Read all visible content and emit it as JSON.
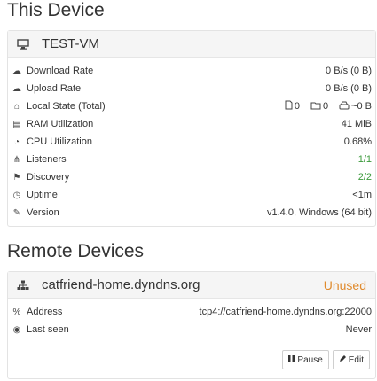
{
  "this_device": {
    "section_title": "This Device",
    "name": "TEST-VM",
    "rows": [
      {
        "icon": "cloud-download-icon",
        "glyph": "☁",
        "label": "Download Rate",
        "value": "0 B/s (0 B)"
      },
      {
        "icon": "cloud-upload-icon",
        "glyph": "☁",
        "label": "Upload Rate",
        "value": "0 B/s (0 B)"
      },
      {
        "icon": "home-icon",
        "glyph": "⌂",
        "label": "Local State (Total)"
      },
      {
        "icon": "memory-icon",
        "glyph": "▤",
        "label": "RAM Utilization",
        "value": "41 MiB"
      },
      {
        "icon": "tachometer-icon",
        "glyph": "◔",
        "label": "CPU Utilization",
        "value": "0.68%"
      },
      {
        "icon": "sitemap-icon",
        "glyph": "⋔",
        "label": "Listeners",
        "value": "1/1"
      },
      {
        "icon": "signpost-icon",
        "glyph": "⚑",
        "label": "Discovery",
        "value": "2/2"
      },
      {
        "icon": "clock-icon",
        "glyph": "◷",
        "label": "Uptime",
        "value": "<1m"
      },
      {
        "icon": "tag-icon",
        "glyph": "✎",
        "label": "Version",
        "value": "v1.4.0, Windows (64 bit)"
      }
    ],
    "local_state": {
      "files": "0",
      "folders": "0",
      "size": "~0 B"
    }
  },
  "remote_devices": {
    "section_title": "Remote Devices",
    "device": {
      "name": "catfriend-home.dyndns.org",
      "status": "Unused",
      "rows": [
        {
          "icon": "link-icon",
          "glyph": "%",
          "label": "Address",
          "value": "tcp4://catfriend-home.dyndns.org:22000"
        },
        {
          "icon": "eye-icon",
          "glyph": "◉",
          "label": "Last seen",
          "value": "Never"
        }
      ],
      "pause_label": "Pause",
      "edit_label": "Edit"
    }
  },
  "colors": {
    "green": "#3c9a3c",
    "orange": "#e08a2c"
  }
}
